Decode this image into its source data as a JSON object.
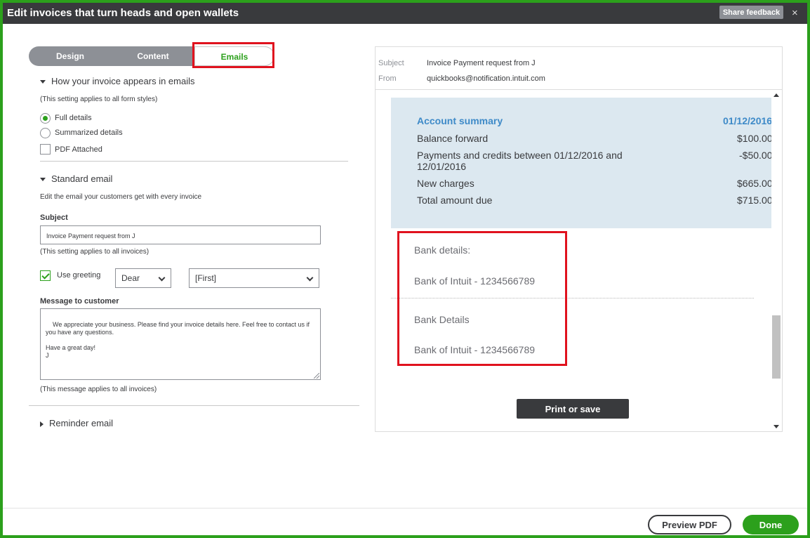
{
  "window": {
    "title": "Edit invoices that turn heads and open wallets",
    "share_feedback": "Share feedback",
    "close_glyph": "×"
  },
  "tabs": [
    {
      "label": "Design"
    },
    {
      "label": "Content"
    },
    {
      "label": "Emails",
      "active": true
    }
  ],
  "appearance": {
    "heading": "How your invoice appears in emails",
    "note": "(This setting applies to all form styles)",
    "options": [
      {
        "label": "Full details",
        "selected": true
      },
      {
        "label": "Summarized details",
        "selected": false
      }
    ],
    "pdf_attached": {
      "label": "PDF Attached",
      "checked": false
    }
  },
  "standard_email": {
    "heading": "Standard email",
    "description": "Edit the email your customers get with every invoice",
    "subject_label": "Subject",
    "subject_value": "Invoice Payment request from J",
    "subject_note": "(This setting applies to all invoices)",
    "use_greeting": {
      "label": "Use greeting",
      "checked": true
    },
    "greeting_options": {
      "salutation": "Dear",
      "name": "[First]"
    },
    "message_label": "Message to customer",
    "message_value": "We appreciate your business. Please find your invoice details here. Feel free to contact us if you have any questions.\n\nHave a great day!\nJ",
    "message_note": "(This message applies to all invoices)"
  },
  "reminder_email": {
    "heading": "Reminder email"
  },
  "preview": {
    "subject_label": "Subject",
    "subject_value": "Invoice Payment request from J",
    "from_label": "From",
    "from_value": "quickbooks@notification.intuit.com",
    "account_summary": {
      "title": "Account summary",
      "date": "01/12/2016",
      "rows": [
        {
          "label": "Balance forward",
          "amount": "$100.00"
        },
        {
          "label": "Payments and credits between 01/12/2016 and 12/01/2016",
          "amount": "-$50.00"
        },
        {
          "label": "New charges",
          "amount": "$665.00"
        },
        {
          "label": "Total amount due",
          "amount": "$715.00"
        }
      ]
    },
    "bank": [
      {
        "heading": "Bank details:",
        "value": "Bank of Intuit - 1234566789"
      },
      {
        "heading": "Bank Details",
        "value": "Bank of Intuit - 1234566789"
      }
    ],
    "print_button": "Print or save"
  },
  "footer": {
    "preview_pdf": "Preview PDF",
    "done": "Done"
  },
  "colors": {
    "accent": "#2ca01c",
    "titlebar": "#393a3d",
    "highlight": "#e0121e",
    "summary_bg": "#dce8f0",
    "summary_title": "#3e8ac8"
  }
}
